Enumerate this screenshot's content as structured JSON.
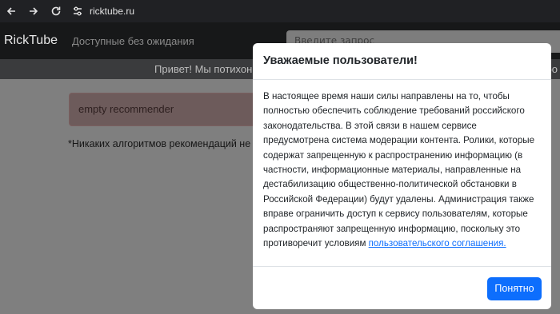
{
  "browser": {
    "url": "ricktube.ru"
  },
  "site": {
    "brand": "RickTube",
    "nav_link": "Доступные без ожидания",
    "search_placeholder": "Введите запрос",
    "greeting": "Привет! Мы потихоньку наращиваем мощности и улучшаем работу сайта. Спасибо за ваше терпение и поддержку!",
    "alert_text": "empty recommender",
    "note_text": "*Никаких алгоритмов рекомендаций не используется"
  },
  "modal": {
    "title": "Уважаемые пользователи!",
    "body_text": "В настоящее время наши силы направлены на то, чтобы полностью обеспечить соблюдение требований российского законодательства. В этой связи в нашем сервисе предусмотрена система модерации контента. Ролики, которые содержат запрещенную к распространению информацию (в частности, информационные материалы, направленные на дестабилизацию общественно-политической обстановки в Российской Федерации) будут удалены. Администрация также вправе ограничить доступ к сервису пользователям, которые распространяют запрещенную информацию, поскольку это противоречит условиям ",
    "link_text": "пользовательского соглашения.",
    "ok_label": "Понятно"
  },
  "colors": {
    "primary": "#0d6efd",
    "backdrop": "#7f7f7f"
  }
}
